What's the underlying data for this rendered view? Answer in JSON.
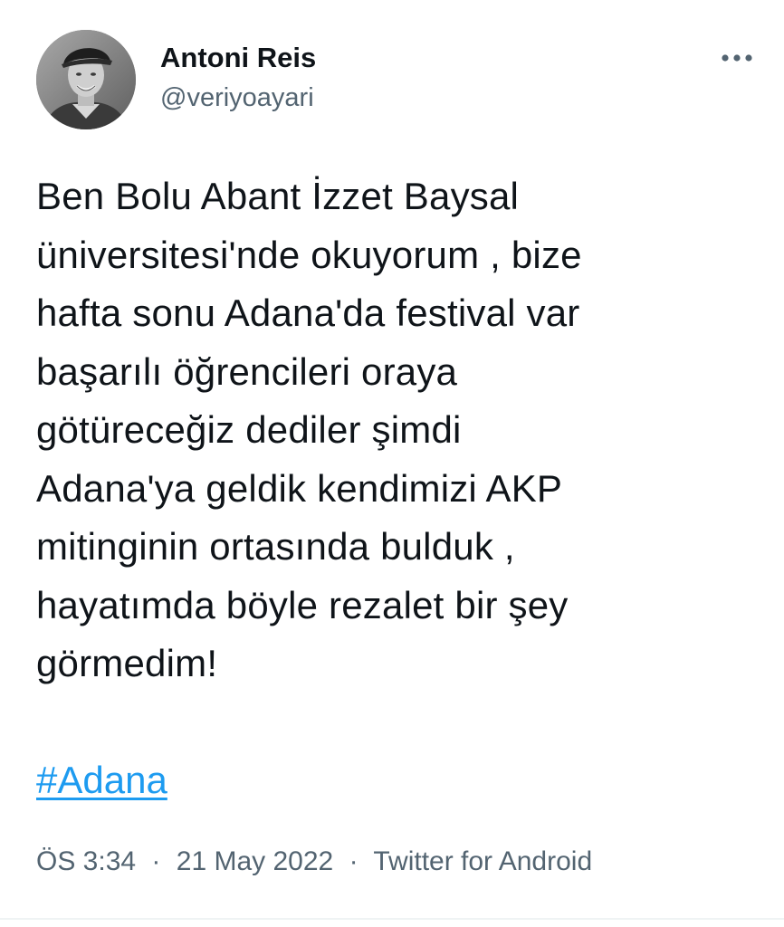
{
  "author": {
    "display_name": "Antoni Reis",
    "handle": "@veriyoayari",
    "avatar_icon": "profile-photo"
  },
  "tweet": {
    "text": "Ben Bolu Abant İzzet Baysal\nüniversitesi'nde okuyorum , bize\nhafta sonu Adana'da festival var\nbaşarılı öğrencileri oraya\ngötüreceğiz dediler şimdi\nAdana'ya geldik kendimizi AKP\nmitinginin ortasında bulduk ,\nhayatımda böyle rezalet bir şey\ngörmedim!",
    "hashtag": "#Adana"
  },
  "meta": {
    "time": "ÖS 3:34",
    "separator": "·",
    "date": "21 May 2022",
    "source": "Twitter for Android"
  },
  "colors": {
    "link": "#1d9bf0",
    "text": "#0f1419",
    "secondary": "#536471"
  }
}
